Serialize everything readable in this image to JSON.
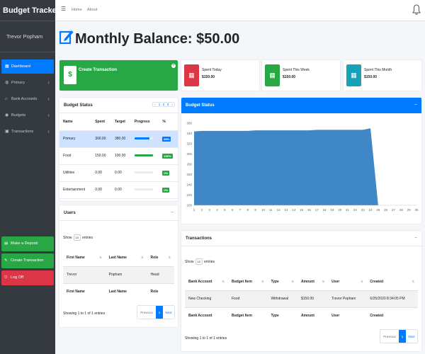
{
  "brand": "Budget Tracker",
  "user_name": "Trevor Popham",
  "nav": [
    {
      "label": "Dashboard",
      "icon": "dashboard-icon",
      "active": true
    },
    {
      "label": "Primary",
      "icon": "wallet-icon",
      "chevron": true
    },
    {
      "label": "Bank Accounts",
      "icon": "bank-icon",
      "chevron": true
    },
    {
      "label": "Budgets",
      "icon": "coins-icon",
      "chevron": true
    },
    {
      "label": "Transactions",
      "icon": "money-icon",
      "chevron": true
    }
  ],
  "side_buttons": {
    "deposit": "Make a Deposit",
    "create": "Create Transaction",
    "logoff": "Log Off"
  },
  "topbar": {
    "home": "Home",
    "about": "About"
  },
  "page_title": "Monthly Balance: $50.00",
  "create_box": {
    "label": "Create Transaction",
    "icon": "dollar-icon"
  },
  "info_boxes": [
    {
      "label": "Spent Today",
      "value": "$150.00",
      "color": "#dc3545",
      "icon": "calendar-icon"
    },
    {
      "label": "Spent This Week",
      "value": "$150.00",
      "color": "#28a745",
      "icon": "calendar-icon"
    },
    {
      "label": "Spent This Month",
      "value": "$150.00",
      "color": "#17a2b8",
      "icon": "calendar-icon"
    }
  ],
  "budget_status_table": {
    "title": "Budget Status",
    "pager": [
      "‹",
      "1",
      "2",
      "3",
      "›"
    ],
    "headers": [
      "Name",
      "Spent",
      "Target",
      "Progress",
      "%"
    ],
    "rows": [
      {
        "name": "Primary",
        "spent": "300.00",
        "target": "380.00",
        "progress": 0.8,
        "pct": "80%",
        "color": "#007bff"
      },
      {
        "name": "Food",
        "spent": "150.00",
        "target": "100.00",
        "progress": 1.0,
        "pct": "150%",
        "color": "#28a745"
      },
      {
        "name": "Utilities",
        "spent": "0.00",
        "target": "0.00",
        "progress": 0,
        "pct": "0%",
        "color": "#28a745"
      },
      {
        "name": "Entertainment",
        "spent": "0.00",
        "target": "0.00",
        "progress": 0,
        "pct": "0%",
        "color": "#28a745"
      }
    ]
  },
  "users_card": {
    "title": "Users",
    "show": "Show",
    "entries_value": "10",
    "entries": "entries",
    "headers": [
      "First Name",
      "Last Name",
      "Role"
    ],
    "rows": [
      [
        "Trevor",
        "Popham",
        "Head"
      ]
    ],
    "info": "Showing 1 to 1 of 1 entries",
    "previous": "Previous",
    "page": "1",
    "next": "Next"
  },
  "chart_card": {
    "title": "Budget Status"
  },
  "chart_data": {
    "type": "area",
    "color": "#3f87c6",
    "x": [
      1,
      2,
      3,
      4,
      5,
      6,
      7,
      8,
      9,
      10,
      11,
      12,
      13,
      14,
      15,
      16,
      17,
      18,
      19,
      20,
      21,
      22,
      23,
      24,
      25,
      26,
      27,
      28,
      29,
      30
    ],
    "values": [
      344,
      345,
      345,
      345,
      345,
      345,
      345,
      345,
      346,
      346,
      346,
      346,
      346,
      346,
      346,
      346,
      347,
      347,
      347,
      347,
      347,
      347,
      347,
      350,
      200
    ],
    "ylim": [
      200,
      360
    ],
    "yticks": [
      200,
      220,
      240,
      260,
      280,
      300,
      320,
      340,
      360
    ],
    "xlabel": "",
    "ylabel": ""
  },
  "transactions_card": {
    "title": "Transactions",
    "show": "Show",
    "entries_value": "10",
    "entries": "entries",
    "headers": [
      "Bank Account",
      "Budget Item",
      "Type",
      "Amount",
      "User",
      "Created"
    ],
    "rows": [
      [
        "New Checking",
        "Food",
        "Withdrawal",
        "$150.00",
        "Trevor Popham",
        "6/25/2020 8:34:05 PM"
      ]
    ],
    "info": "Showing 1 to 1 of 1 entries",
    "previous": "Previous",
    "page": "1",
    "next": "Next"
  }
}
